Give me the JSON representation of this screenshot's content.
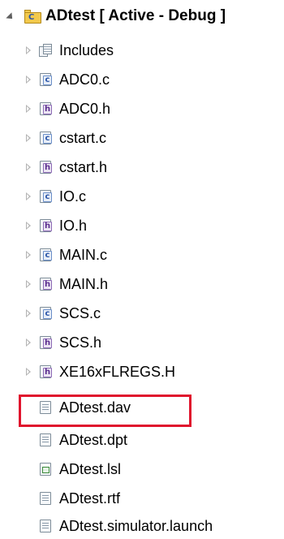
{
  "project": {
    "name": "ADtest",
    "configuration": "[ Active - Debug ]"
  },
  "items": [
    {
      "label": "Includes",
      "icon": "includes-icon",
      "expandable": true
    },
    {
      "label": "ADC0.c",
      "icon": "c-file-icon",
      "expandable": true
    },
    {
      "label": "ADC0.h",
      "icon": "h-file-icon",
      "expandable": true
    },
    {
      "label": "cstart.c",
      "icon": "c-file-icon",
      "expandable": true
    },
    {
      "label": "cstart.h",
      "icon": "h-file-icon",
      "expandable": true
    },
    {
      "label": "IO.c",
      "icon": "c-file-icon",
      "expandable": true
    },
    {
      "label": "IO.h",
      "icon": "h-file-icon",
      "expandable": true
    },
    {
      "label": "MAIN.c",
      "icon": "c-file-icon",
      "expandable": true
    },
    {
      "label": "MAIN.h",
      "icon": "h-file-icon",
      "expandable": true
    },
    {
      "label": "SCS.c",
      "icon": "c-file-icon",
      "expandable": true
    },
    {
      "label": "SCS.h",
      "icon": "h-file-icon",
      "expandable": true
    },
    {
      "label": "XE16xFLREGS.H",
      "icon": "h-file-icon",
      "expandable": true
    },
    {
      "label": "ADtest.dav",
      "icon": "document-file-icon",
      "expandable": false,
      "highlighted": true
    },
    {
      "label": "ADtest.dpt",
      "icon": "document-file-icon",
      "expandable": false
    },
    {
      "label": "ADtest.lsl",
      "icon": "linker-script-file-icon",
      "expandable": false
    },
    {
      "label": "ADtest.rtf",
      "icon": "document-file-icon",
      "expandable": false
    },
    {
      "label": "ADtest.simulator.launch",
      "icon": "document-file-icon",
      "expandable": false
    }
  ],
  "colors": {
    "highlight": "#e0142d",
    "folder": "#f2c94c"
  }
}
